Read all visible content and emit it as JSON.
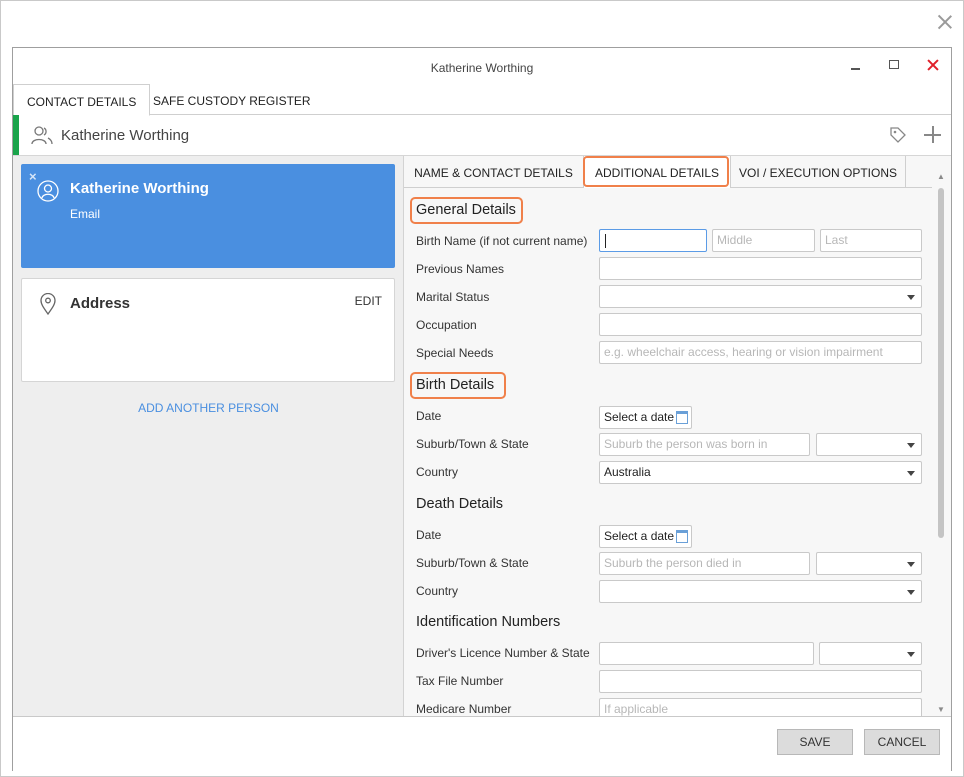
{
  "window": {
    "title": "Katherine Worthing"
  },
  "top_tabs": [
    "CONTACT DETAILS",
    "SAFE CUSTODY REGISTER"
  ],
  "header": {
    "name": "Katherine Worthing"
  },
  "left": {
    "person_card": {
      "name": "Katherine Worthing",
      "sub": "Email"
    },
    "address_card": {
      "title": "Address",
      "edit": "EDIT"
    },
    "add_person": "ADD ANOTHER PERSON"
  },
  "right_tabs": [
    "NAME & CONTACT DETAILS",
    "ADDITIONAL DETAILS",
    "VOI / EXECUTION OPTIONS"
  ],
  "general": {
    "title": "General Details",
    "birth_name_label": "Birth Name (if not current name)",
    "birth_name_placeholders": {
      "first": "",
      "middle": "Middle",
      "last": "Last"
    },
    "previous_names_label": "Previous Names",
    "marital_status_label": "Marital Status",
    "occupation_label": "Occupation",
    "special_needs_label": "Special Needs",
    "special_needs_placeholder": "e.g. wheelchair access, hearing or vision impairment"
  },
  "birth": {
    "title": "Birth Details",
    "date_label": "Date",
    "date_button": "Select a date",
    "suburb_label": "Suburb/Town & State",
    "suburb_placeholder": "Suburb the person was born in",
    "country_label": "Country",
    "country_value": "Australia"
  },
  "death": {
    "title": "Death Details",
    "date_label": "Date",
    "date_button": "Select a date",
    "suburb_label": "Suburb/Town & State",
    "suburb_placeholder": "Suburb the person died in",
    "country_label": "Country"
  },
  "identification": {
    "title": "Identification Numbers",
    "licence_label": "Driver's Licence Number & State",
    "tfn_label": "Tax File Number",
    "medicare_label": "Medicare Number",
    "medicare_placeholder": "If applicable"
  },
  "footer": {
    "save": "SAVE",
    "cancel": "CANCEL"
  },
  "colors": {
    "accent_blue": "#4a8fe0",
    "green_bar": "#1aa44b",
    "highlight": "#f0804a",
    "close_red": "#e0202a"
  }
}
